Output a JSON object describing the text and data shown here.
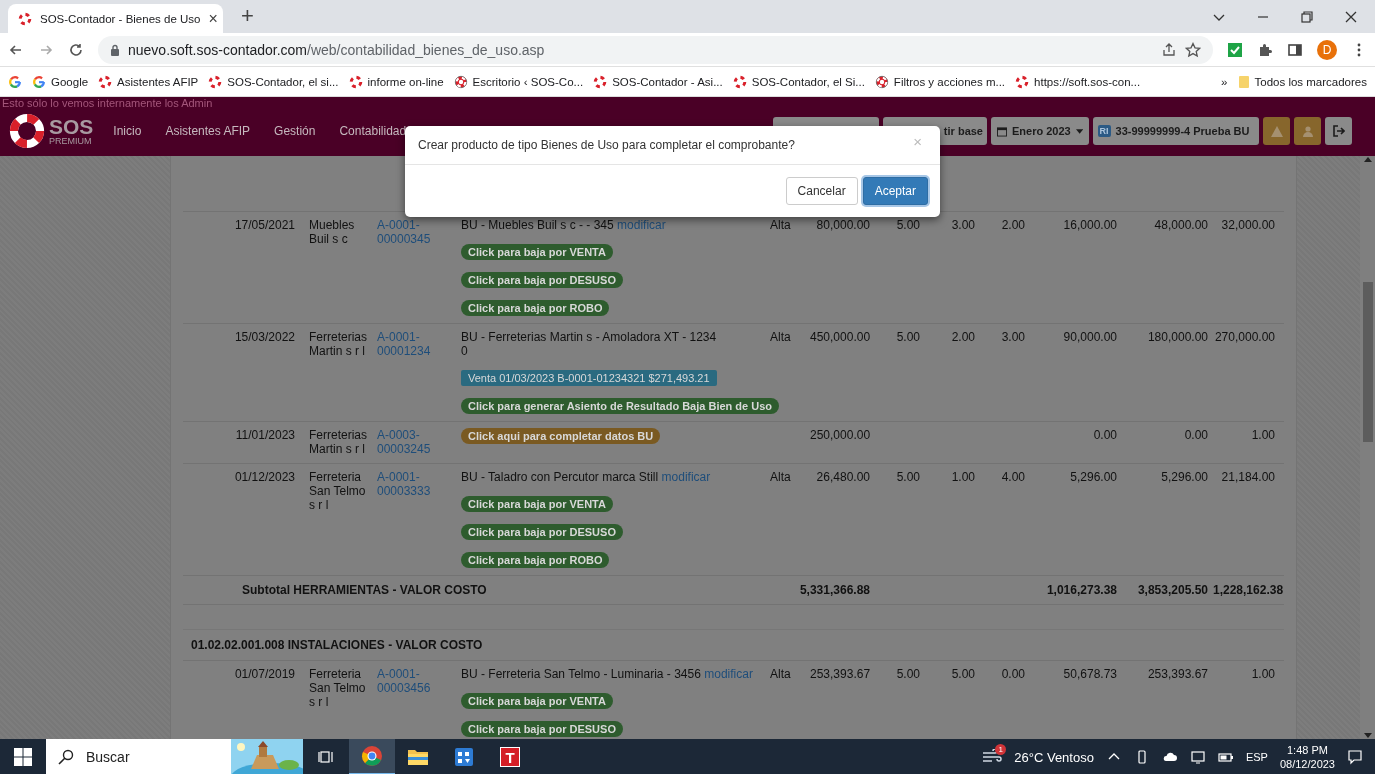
{
  "browser": {
    "tab_title": "SOS-Contador - Bienes de Uso",
    "close": "×",
    "new_tab": "+",
    "url_host": "nuevo.soft.sos-contador.com",
    "url_path": "/web/contabilidad_bienes_de_uso.asp",
    "avatar": "D",
    "bookmarks": [
      {
        "kind": "google"
      },
      {
        "kind": "google",
        "label": "Google"
      },
      {
        "kind": "sos",
        "label": "Asistentes AFIP"
      },
      {
        "kind": "sos",
        "label": "SOS-Contador, el si..."
      },
      {
        "kind": "sos",
        "label": "informe on-line"
      },
      {
        "kind": "ring",
        "label": "Escritorio ‹ SOS-Co..."
      },
      {
        "kind": "sos",
        "label": "SOS-Contador - Asi..."
      },
      {
        "kind": "sos",
        "label": "SOS-Contador, el Si..."
      },
      {
        "kind": "ring",
        "label": "Filtros y acciones m..."
      },
      {
        "kind": "sos",
        "label": "https://soft.sos-con..."
      }
    ],
    "overflow": "»",
    "folder": "Todos los marcadores"
  },
  "app": {
    "admin_note": "Esto sólo lo vemos internamente los Admin",
    "logo": {
      "name": "SOS",
      "tagline": "PREMIUM"
    },
    "nav": [
      "Inicio",
      "Asistentes AFIP",
      "Gestión",
      "Contabilidad"
    ],
    "toolbar": {
      "partial_button": "tir base",
      "period": "Enero 2023",
      "company_badge": "RI",
      "company": "33-99999999-4 Prueba BU"
    }
  },
  "table": {
    "rows": [
      {
        "kind": "item",
        "date": "17/05/2021",
        "supplier": "Muebles Buil s c",
        "voucher": "A-0001-00000345",
        "description": "BU - Muebles Buil s c - - 345",
        "modify": "modificar",
        "type": "Alta",
        "amount": "80,000.00",
        "rate": "5.00",
        "used": "3.00",
        "remaining": "2.00",
        "depreciation": "16,000.00",
        "accumulated": "48,000.00",
        "residual": "32,000.00",
        "badges": [
          {
            "kind": "action",
            "text": "Click para baja por VENTA"
          },
          {
            "kind": "action",
            "text": "Click para baja por DESUSO"
          },
          {
            "kind": "action",
            "text": "Click para baja por ROBO"
          }
        ]
      },
      {
        "kind": "item",
        "date": "15/03/2022",
        "supplier": "Ferreterias Martin s r l",
        "voucher": "A-0001-00001234",
        "description": "BU - Ferreterias Martin s - Amoladora XT - 1234\n0",
        "type": "Alta",
        "amount": "450,000.00",
        "rate": "5.00",
        "used": "2.00",
        "remaining": "3.00",
        "depreciation": "90,000.00",
        "accumulated": "180,000.00",
        "residual": "270,000.00",
        "badges": [
          {
            "kind": "sale",
            "text": "Venta 01/03/2023 B-0001-01234321 $271,493.21"
          },
          {
            "kind": "action",
            "text": "Click para generar Asiento de Resultado Baja Bien de Uso"
          }
        ]
      },
      {
        "kind": "item",
        "date": "11/01/2023",
        "supplier": "Ferreterias Martin s r l",
        "voucher": "A-0003-00003245",
        "amount": "250,000.00",
        "depreciation": "0.00",
        "accumulated": "0.00",
        "residual": "1.00",
        "badges": [
          {
            "kind": "pending",
            "text": "Click aqui para completar datos BU"
          }
        ]
      },
      {
        "kind": "item",
        "date": "01/12/2023",
        "supplier": "Ferreteria San Telmo s r l",
        "voucher": "A-0001-00003333",
        "description": "BU - Taladro con Percutor marca Still",
        "modify": "modificar",
        "type": "Alta",
        "amount": "26,480.00",
        "rate": "5.00",
        "used": "1.00",
        "remaining": "4.00",
        "depreciation": "5,296.00",
        "accumulated": "5,296.00",
        "residual": "21,184.00",
        "badges": [
          {
            "kind": "action",
            "text": "Click para baja por VENTA"
          },
          {
            "kind": "action",
            "text": "Click para baja por DESUSO"
          },
          {
            "kind": "action",
            "text": "Click para baja por ROBO"
          }
        ]
      },
      {
        "kind": "subtotal",
        "label": "Subtotal HERRAMIENTAS - VALOR COSTO",
        "amount": "5,331,366.88",
        "depreciation": "1,016,273.38",
        "accumulated": "3,853,205.50",
        "residual": "1,228,162.38"
      },
      {
        "kind": "section",
        "label": "01.02.02.001.008 INSTALACIONES - VALOR COSTO"
      },
      {
        "kind": "item",
        "date": "01/07/2019",
        "supplier": "Ferreteria San Telmo s r l",
        "voucher": "A-0001-00003456",
        "description": "BU - Ferreteria San Telmo - Luminaria - 3456",
        "modify": "modificar",
        "type": "Alta",
        "amount": "253,393.67",
        "rate": "5.00",
        "used": "5.00",
        "remaining": "0.00",
        "depreciation": "50,678.73",
        "accumulated": "253,393.67",
        "residual": "1.00",
        "badges": [
          {
            "kind": "action",
            "text": "Click para baja por VENTA"
          },
          {
            "kind": "action",
            "text": "Click para baja por DESUSO"
          }
        ]
      }
    ]
  },
  "modal": {
    "message": "Crear producto de tipo Bienes de Uso para completar el comprobante?",
    "close": "×",
    "buttons": [
      {
        "kind": "default",
        "label": "Cancelar"
      },
      {
        "kind": "primary",
        "label": "Aceptar"
      }
    ]
  },
  "taskbar": {
    "search_placeholder": "Buscar",
    "apps": [
      {
        "kind": "chrome",
        "selected": true
      },
      {
        "kind": "folder",
        "selected": false
      },
      {
        "kind": "store",
        "selected": false
      },
      {
        "kind": "letter",
        "label": "T",
        "selected": false
      }
    ],
    "weather_badge": "1",
    "weather": "26°C Ventoso",
    "language": "ESP",
    "time": "1:48 PM",
    "date": "08/12/2023"
  }
}
